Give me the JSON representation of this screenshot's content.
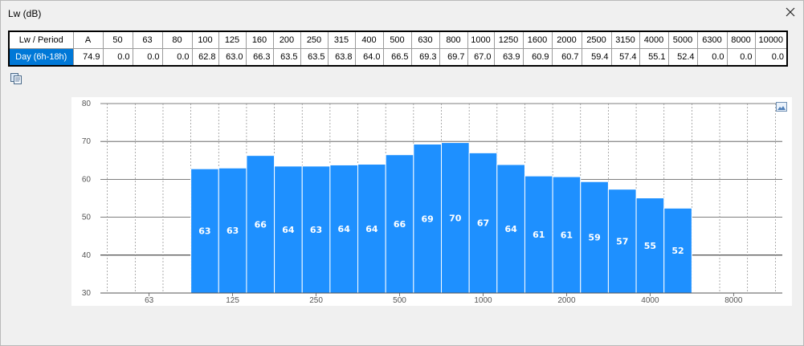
{
  "window": {
    "title": "Lw (dB)"
  },
  "table": {
    "corner_label": "Lw / Period",
    "columns": [
      "A",
      "50",
      "63",
      "80",
      "100",
      "125",
      "160",
      "200",
      "250",
      "315",
      "400",
      "500",
      "630",
      "800",
      "1000",
      "1250",
      "1600",
      "2000",
      "2500",
      "3150",
      "4000",
      "5000",
      "6300",
      "8000",
      "10000"
    ],
    "rows": [
      {
        "label": "Day (6h-18h)",
        "values": [
          "74.9",
          "0.0",
          "0.0",
          "0.0",
          "62.8",
          "63.0",
          "66.3",
          "63.5",
          "63.5",
          "63.8",
          "64.0",
          "66.5",
          "69.3",
          "69.7",
          "67.0",
          "63.9",
          "60.9",
          "60.7",
          "59.4",
          "57.4",
          "55.1",
          "52.4",
          "0.0",
          "0.0",
          "0.0"
        ]
      }
    ]
  },
  "icons": {
    "close": "close-icon",
    "copy": "copy-icon",
    "chart_tool": "chart-image-icon"
  },
  "colors": {
    "bar": "#1e90ff",
    "row_highlight": "#0078d7"
  },
  "chart_data": {
    "type": "bar",
    "categories": [
      "50",
      "63",
      "80",
      "100",
      "125",
      "160",
      "200",
      "250",
      "315",
      "400",
      "500",
      "630",
      "800",
      "1000",
      "1250",
      "1600",
      "2000",
      "2500",
      "3150",
      "4000",
      "5000",
      "6300",
      "8000",
      "10000"
    ],
    "values": [
      0,
      0,
      0,
      62.8,
      63.0,
      66.3,
      63.5,
      63.5,
      63.8,
      64.0,
      66.5,
      69.3,
      69.7,
      67.0,
      63.9,
      60.9,
      60.7,
      59.4,
      57.4,
      55.1,
      52.4,
      0,
      0,
      0
    ],
    "data_labels": [
      "",
      "",
      "",
      "63",
      "63",
      "66",
      "64",
      "63",
      "64",
      "64",
      "66",
      "69",
      "70",
      "67",
      "64",
      "61",
      "61",
      "59",
      "57",
      "55",
      "52",
      "",
      "",
      ""
    ],
    "x_tick_labels": [
      "63",
      "125",
      "250",
      "500",
      "1000",
      "2000",
      "4000",
      "8000"
    ],
    "y_ticks": [
      30,
      40,
      50,
      60,
      70,
      80
    ],
    "ylim": [
      30,
      80
    ],
    "title": "",
    "xlabel": "",
    "ylabel": "",
    "grid": true
  }
}
